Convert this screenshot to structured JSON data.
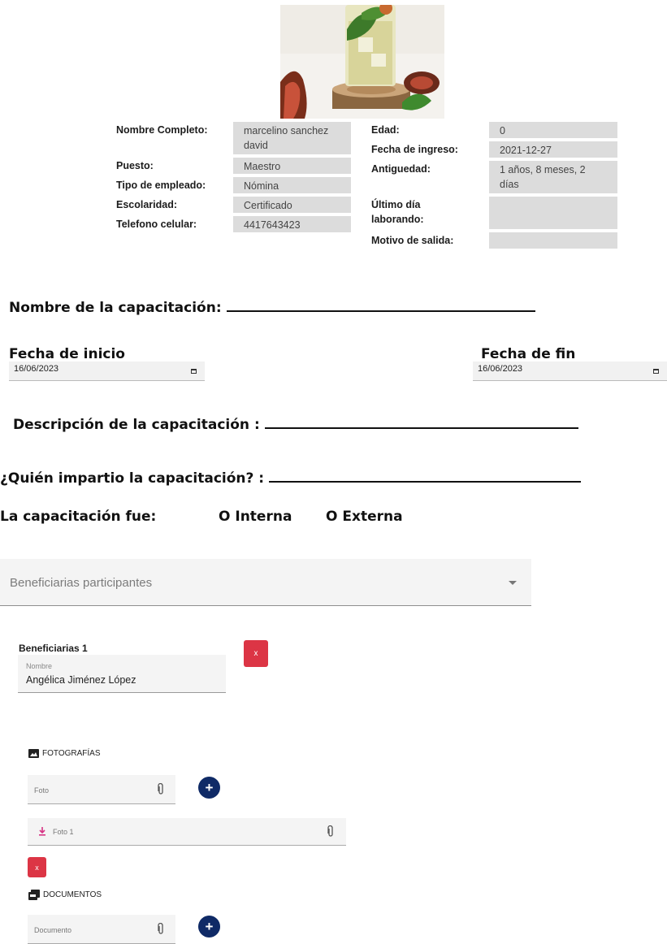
{
  "employee": {
    "fields_left": [
      {
        "label": "Nombre Completo:",
        "value": "marcelino sanchez david"
      },
      {
        "label": "Puesto:",
        "value": "Maestro"
      },
      {
        "label": "Tipo de empleado:",
        "value": "Nómina"
      },
      {
        "label": "Escolaridad:",
        "value": "Certificado"
      },
      {
        "label": "Telefono celular:",
        "value": "4417643423"
      }
    ],
    "fields_right": [
      {
        "label": "Edad:",
        "value": "0"
      },
      {
        "label": "Fecha de ingreso:",
        "value": "2021-12-27"
      },
      {
        "label": "Antiguedad:",
        "value": "1 años, 8 meses, 2 días"
      },
      {
        "label": "Último día laborando:",
        "value": ""
      },
      {
        "label": "Motivo de salida:",
        "value": ""
      }
    ]
  },
  "training": {
    "name_label": "Nombre de la capacitación:",
    "start_label": "Fecha de inicio",
    "start_value": "16/06/2023",
    "end_label": "Fecha de fin",
    "end_value": "16/06/2023",
    "description_label": "Descripción de la capacitación :",
    "who_label": "¿Quién impartio la capacitación? :",
    "type_label": "La capacitación fue:",
    "option_internal": "O Interna",
    "option_external": "O Externa"
  },
  "beneficiaries_select": {
    "placeholder": "Beneficiarias participantes"
  },
  "beneficiary": {
    "title": "Beneficiarias 1",
    "field_label": "Nombre",
    "field_value": "Angélica Jiménez López",
    "remove_label": "x"
  },
  "photos": {
    "title": "FOTOGRAFÍAS",
    "input_placeholder": "Foto",
    "file_name": "Foto 1",
    "remove_label": "x",
    "add_label": "+"
  },
  "documents": {
    "title": "DOCUMENTOS",
    "input_placeholder": "Documento",
    "add_label": "+"
  },
  "colors": {
    "red": "#dc3545",
    "navy": "#0f2a66",
    "field_bg": "#dcdcdc",
    "download_pink": "#d63384"
  },
  "icons": [
    "image-icon",
    "pdf-icon",
    "paperclip-icon",
    "calendar-icon",
    "download-icon",
    "caret-down-icon",
    "plus-icon"
  ]
}
